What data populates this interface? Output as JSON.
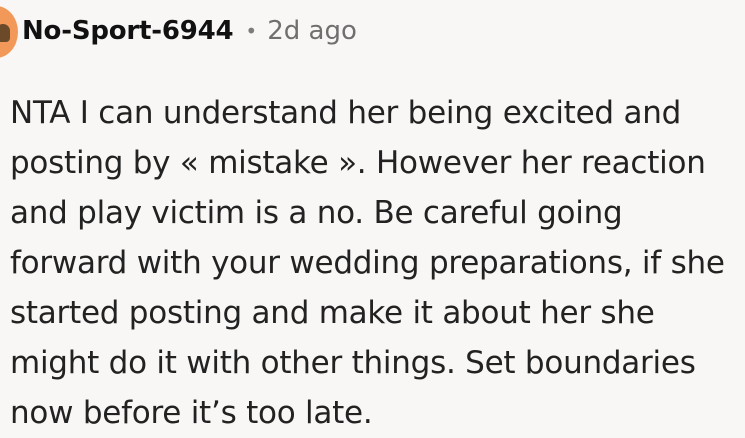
{
  "comment": {
    "author": "No-Sport-6944",
    "separator": "•",
    "timestamp": "2d ago",
    "body_lines": [
      "NTA I can understand her being excited and",
      "posting by « mistake ». However her reaction",
      "and play victim is a no. Be careful going",
      "forward with your wedding preparations, if she",
      "started posting and make it about her she",
      "might do it with other things. Set boundaries",
      "now before it’s too late."
    ]
  },
  "colors": {
    "background": "#f9f7f6",
    "avatar": "#f2995a",
    "text": "#222222",
    "muted": "#6f6f6f"
  },
  "icons": {
    "avatar": "user-avatar-icon"
  }
}
